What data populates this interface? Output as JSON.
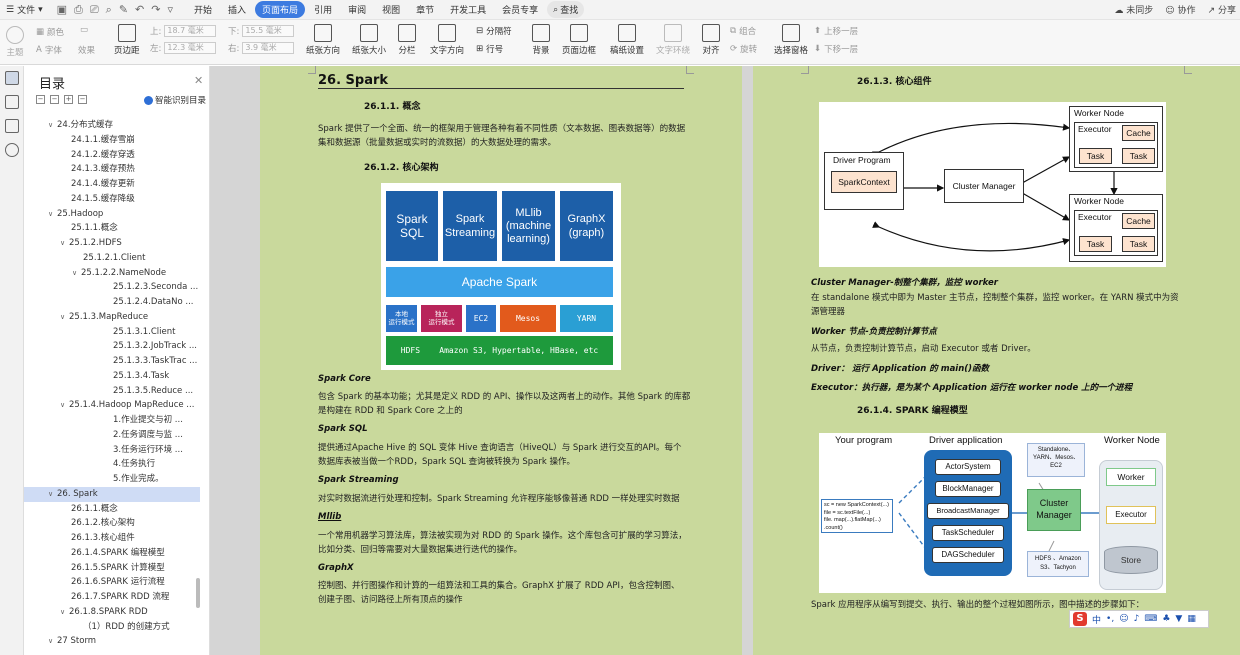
{
  "menubar": {
    "file_label": "文件",
    "tabs": [
      "开始",
      "插入",
      "页面布局",
      "引用",
      "审阅",
      "视图",
      "章节",
      "开发工具",
      "会员专享"
    ],
    "active_tab": "页面布局",
    "search_label": "查找",
    "right": [
      "未同步",
      "协作",
      "分享"
    ]
  },
  "ribbon": {
    "theme": "主题",
    "colors": "颜色",
    "fonts": "字体",
    "effects": "效果",
    "margins": "页边距",
    "top_label": "上:",
    "top_value": "18.7 毫米",
    "bottom_label": "下:",
    "bottom_value": "15.5 毫米",
    "left_label": "左:",
    "left_value": "12.3 毫米",
    "right_label": "右:",
    "right_value": "3.9 毫米",
    "orientation": "纸张方向",
    "size": "纸张大小",
    "columns": "分栏",
    "text_dir": "文字方向",
    "breaks": "分隔符",
    "line_num": "行号",
    "background": "背景",
    "page_border": "页面边框",
    "paper_setup": "稿纸设置",
    "wrap": "文字环绕",
    "align": "对齐",
    "group": "组合",
    "rotate": "旋转",
    "select_pane": "选择窗格",
    "bring_forward": "上移一层",
    "send_backward": "下移一层"
  },
  "toc": {
    "title": "目录",
    "smart": "智能识别目录",
    "items": [
      {
        "text": "24.分布式缓存",
        "level": 1,
        "caret": "down"
      },
      {
        "text": "24.1.1.缓存雪崩",
        "level": 2
      },
      {
        "text": "24.1.2.缓存穿透",
        "level": 2
      },
      {
        "text": "24.1.3.缓存预热",
        "level": 2
      },
      {
        "text": "24.1.4.缓存更新",
        "level": 2
      },
      {
        "text": "24.1.5.缓存降级",
        "level": 2
      },
      {
        "text": "25.Hadoop",
        "level": 1,
        "caret": "down"
      },
      {
        "text": "25.1.1.概念",
        "level": 2
      },
      {
        "text": "25.1.2.HDFS",
        "level": 2,
        "caret": "down"
      },
      {
        "text": "25.1.2.1.Client",
        "level": 3
      },
      {
        "text": "25.1.2.2.NameNode",
        "level": 3,
        "caret": "down"
      },
      {
        "text": "25.1.2.3.Seconda ...",
        "level": 4
      },
      {
        "text": "25.1.2.4.DataNo ...",
        "level": 4
      },
      {
        "text": "25.1.3.MapReduce",
        "level": 2,
        "caret": "down"
      },
      {
        "text": "25.1.3.1.Client",
        "level": 4
      },
      {
        "text": "25.1.3.2.JobTrack ...",
        "level": 4
      },
      {
        "text": "25.1.3.3.TaskTrac ...",
        "level": 4
      },
      {
        "text": "25.1.3.4.Task",
        "level": 4
      },
      {
        "text": "25.1.3.5.Reduce ...",
        "level": 4
      },
      {
        "text": "25.1.4.Hadoop MapReduce ...",
        "level": 2,
        "caret": "down"
      },
      {
        "text": "1.作业提交与初 ...",
        "level": 4
      },
      {
        "text": "2.任务调度与监 ...",
        "level": 4
      },
      {
        "text": "3.任务运行环境 ...",
        "level": 4
      },
      {
        "text": "4.任务执行",
        "level": 4
      },
      {
        "text": "5.作业完成。",
        "level": 4
      },
      {
        "text": "26. Spark",
        "level": 1,
        "caret": "down",
        "selected": true
      },
      {
        "text": "26.1.1.概念",
        "level": 2
      },
      {
        "text": "26.1.2.核心架构",
        "level": 2
      },
      {
        "text": "26.1.3.核心组件",
        "level": 2
      },
      {
        "text": "26.1.4.SPARK 编程模型",
        "level": 2
      },
      {
        "text": "26.1.5.SPARK 计算模型",
        "level": 2
      },
      {
        "text": "26.1.6.SPARK 运行流程",
        "level": 2
      },
      {
        "text": "26.1.7.SPARK RDD 流程",
        "level": 2
      },
      {
        "text": "26.1.8.SPARK RDD",
        "level": 2,
        "caret": "down"
      },
      {
        "text": "（1）RDD 的创建方式",
        "level": 3
      },
      {
        "text": "27 Storm",
        "level": 1,
        "caret": "down"
      }
    ]
  },
  "page1": {
    "h1": "26.  Spark",
    "s1_title": "26.1.1.    概念",
    "s1_body1": "Spark 提供了一个全面、统一的框架用于管理各种有着不同性质（文本数据、图表数据等）的数据",
    "s1_body2": "集和数据源（批量数据或实时的流数据）的大数据处理的需求。",
    "s2_title": "26.1.2.    核心架构",
    "fig": {
      "spark_sql": "Spark\nSQL",
      "spark_streaming": "Spark\nStreaming",
      "mllib": "MLlib\n(machine\nlearning)",
      "graphx": "GraphX\n(graph)",
      "apache_spark": "Apache Spark",
      "local": "本地\n运行模式",
      "standalone": "独立\n运行模式",
      "ec2": "EC2",
      "mesos": "Mesos",
      "yarn": "YARN",
      "storage": "HDFS    Amazon S3, Hypertable, HBase, etc"
    },
    "core_term": "Spark Core",
    "core_body1": "包含 Spark 的基本功能；尤其是定义 RDD 的 API、操作以及这两者上的动作。其他 Spark 的库都",
    "core_body2": "是构建在 RDD 和 Spark Core 之上的",
    "sql_term": "Spark SQL",
    "sql_body1": "提供通过Apache Hive 的 SQL 变体 Hive 查询语言（HiveQL）与 Spark 进行交互的API。每个",
    "sql_body2": "数据库表被当做一个RDD，Spark SQL 查询被转换为 Spark 操作。",
    "streaming_term": "Spark Streaming",
    "streaming_body": "对实时数据流进行处理和控制。Spark Streaming 允许程序能够像普通 RDD 一样处理实时数据",
    "mllib_term": "Mllib",
    "mllib_body1": "一个常用机器学习算法库，算法被实现为对 RDD 的 Spark 操作。这个库包含可扩展的学习算法，",
    "mllib_body2": "比如分类、回归等需要对大量数据集进行迭代的操作。",
    "graphx_term": "GraphX",
    "graphx_body1": "控制图、并行图操作和计算的一组算法和工具的集合。GraphX 扩展了 RDD API，包含控制图、",
    "graphx_body2": "创建子图、访问路径上所有顶点的操作"
  },
  "page2": {
    "s3_title": "26.1.3.    核心组件",
    "cluster_fig": {
      "driver_program": "Driver Program",
      "spark_context": "SparkContext",
      "cluster_manager": "Cluster Manager",
      "worker_node": "Worker Node",
      "executor": "Executor",
      "cache": "Cache",
      "task": "Task"
    },
    "cm_term": "Cluster Manager-制整个集群，监控 worker",
    "cm_body1": "在 standalone 模式中即为 Master 主节点，控制整个集群，监控 worker。在 YARN 模式中为资",
    "cm_body2": "源管理器",
    "worker_term": "Worker 节点-负责控制计算节点",
    "worker_body": "从节点，负责控制计算节点，启动 Executor 或者 Driver。",
    "driver_term": "Driver：  运行  Application  的  main()函数",
    "executor_term": "Executor：执行器，是为某个 Application 运行在 worker node 上的一个进程",
    "s4_title": "26.1.4.    SPARK 编程模型",
    "prog_fig": {
      "your_program": "Your program",
      "driver_app": "Driver application",
      "worker_node": "Worker Node",
      "code": [
        "sc = new SparkContext(...)",
        "file = sc.textFile(...)",
        "file. map(...).flatMap(...)",
        ".count()"
      ],
      "actor_system": "ActorSystem",
      "block_manager": "BlockManager",
      "broadcast_manager": "BroadcastManager",
      "task_scheduler": "TaskScheduler",
      "dag_scheduler": "DAGScheduler",
      "cm_note": "Standalone、\nYARN、Mesos、\nEC2",
      "cluster_manager": "Cluster\nManager",
      "storage_note": "HDFS 、Amazon\nS3、Tachyon",
      "worker": "Worker",
      "executor": "Executor",
      "store": "Store"
    },
    "prog_body": "Spark 应用程序从编写到提交、执行、输出的整个过程如图所示，图中描述的步骤如下："
  },
  "ime": {
    "logo": "S",
    "lang": "中"
  }
}
